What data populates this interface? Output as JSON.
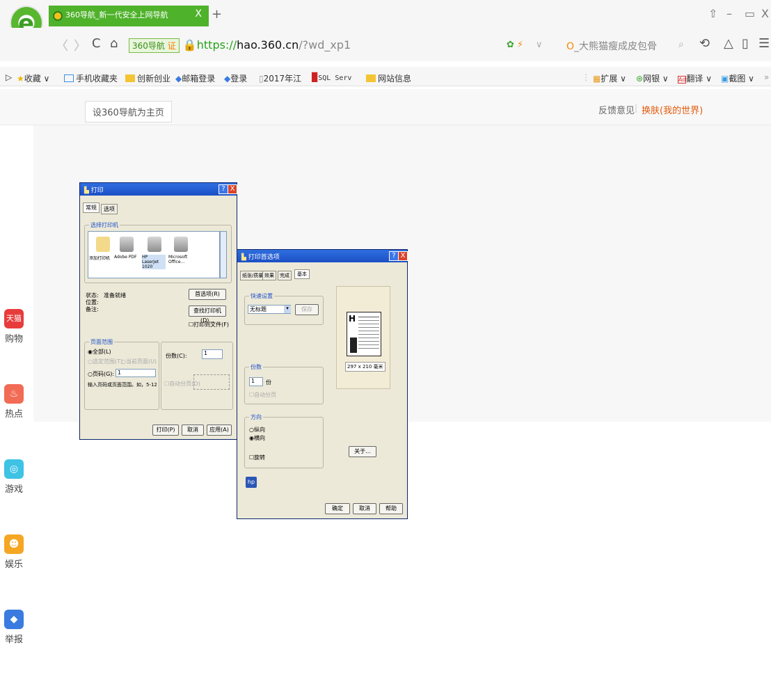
{
  "tab": {
    "title": "360导航_新一代安全上网导航",
    "close": "X",
    "new": "+"
  },
  "window": {
    "restore": "⇧",
    "minimize": "–",
    "maximize": "▭",
    "close": "X"
  },
  "nav": {
    "back": "〈",
    "forward": "〉",
    "reload": "C",
    "home": "⌂",
    "badge": "360导航",
    "badge_cert": "证",
    "url_scheme": "https://",
    "url_domain": "hao.360.cn",
    "url_path": "/?wd_xp1",
    "search_placeholder": "大熊猫瘦成皮包骨",
    "undo": "⟲",
    "search_icon": "⌕"
  },
  "bookmarks": [
    {
      "label": "收藏"
    },
    {
      "label": "手机收藏夹"
    },
    {
      "label": "创新创业"
    },
    {
      "label": "邮箱登录"
    },
    {
      "label": "登录"
    },
    {
      "label": "2017年江"
    },
    {
      "label": "SQL Serv"
    },
    {
      "label": "网站信息"
    }
  ],
  "tools": [
    {
      "label": "扩展"
    },
    {
      "label": "网银"
    },
    {
      "label": "翻译"
    },
    {
      "label": "截图"
    },
    {
      "label": "»"
    }
  ],
  "page": {
    "sethome": "设360导航为主页",
    "feedback": "反馈意见",
    "divider": "|",
    "skin": "换肤(我的世界)"
  },
  "rail": [
    {
      "icon_text": "天猫",
      "label": "购物",
      "color": "#e83c3c"
    },
    {
      "icon_text": "♨",
      "label": "热点",
      "color": "#f26b55"
    },
    {
      "icon_text": "🎮",
      "label": "游戏",
      "color": "#3ec3e5"
    },
    {
      "icon_text": "☻",
      "label": "娱乐",
      "color": "#f5a623"
    },
    {
      "icon_text": "◆",
      "label": "举报",
      "color": "#3a7be0"
    }
  ],
  "print_dialog": {
    "title": "打印",
    "help": "?",
    "close": "X",
    "tabs": [
      "常规",
      "选项"
    ],
    "select_printer": "选择打印机",
    "printers": [
      "添加打印机",
      "Adobe PDF",
      "HP LaserJet 1020",
      "Microsoft Office..."
    ],
    "status_label": "状态:",
    "status_value": "准备就绪",
    "location_label": "位置:",
    "comment_label": "备注:",
    "prefs": "首选项(R)",
    "find_printer": "查找打印机(D)...",
    "print_to_file": "打印到文件(F)",
    "page_range": "页面范围",
    "all": "全部(L)",
    "selection": "选定范围(T)",
    "current_page": "当前页面(U)",
    "pages": "页码(G):",
    "pages_value": "1",
    "pages_hint": "输入页码或页面范围。如，5-12",
    "copies": "份数(C):",
    "copies_value": "1",
    "collate": "自动分页(O)",
    "print": "打印(P)",
    "cancel": "取消",
    "apply": "应用(A)"
  },
  "pref_dialog": {
    "title": "打印首选项",
    "help": "?",
    "close": "X",
    "tabs": [
      "纸张/质量",
      "效果",
      "完成",
      "基本"
    ],
    "quick_set": "快速设置",
    "quick_value": "无标题",
    "save": "保存",
    "copies": "份数",
    "copies_value": "1",
    "copies_unit": "份",
    "collate": "自动分页",
    "orientation": "方向",
    "portrait": "纵向",
    "landscape": "横向",
    "rotate": "旋转",
    "paper_size": "297 x 210 毫米",
    "about": "关于...",
    "hp_logo": "hp",
    "ok": "确定",
    "cancel": "取消",
    "help_btn": "帮助"
  }
}
